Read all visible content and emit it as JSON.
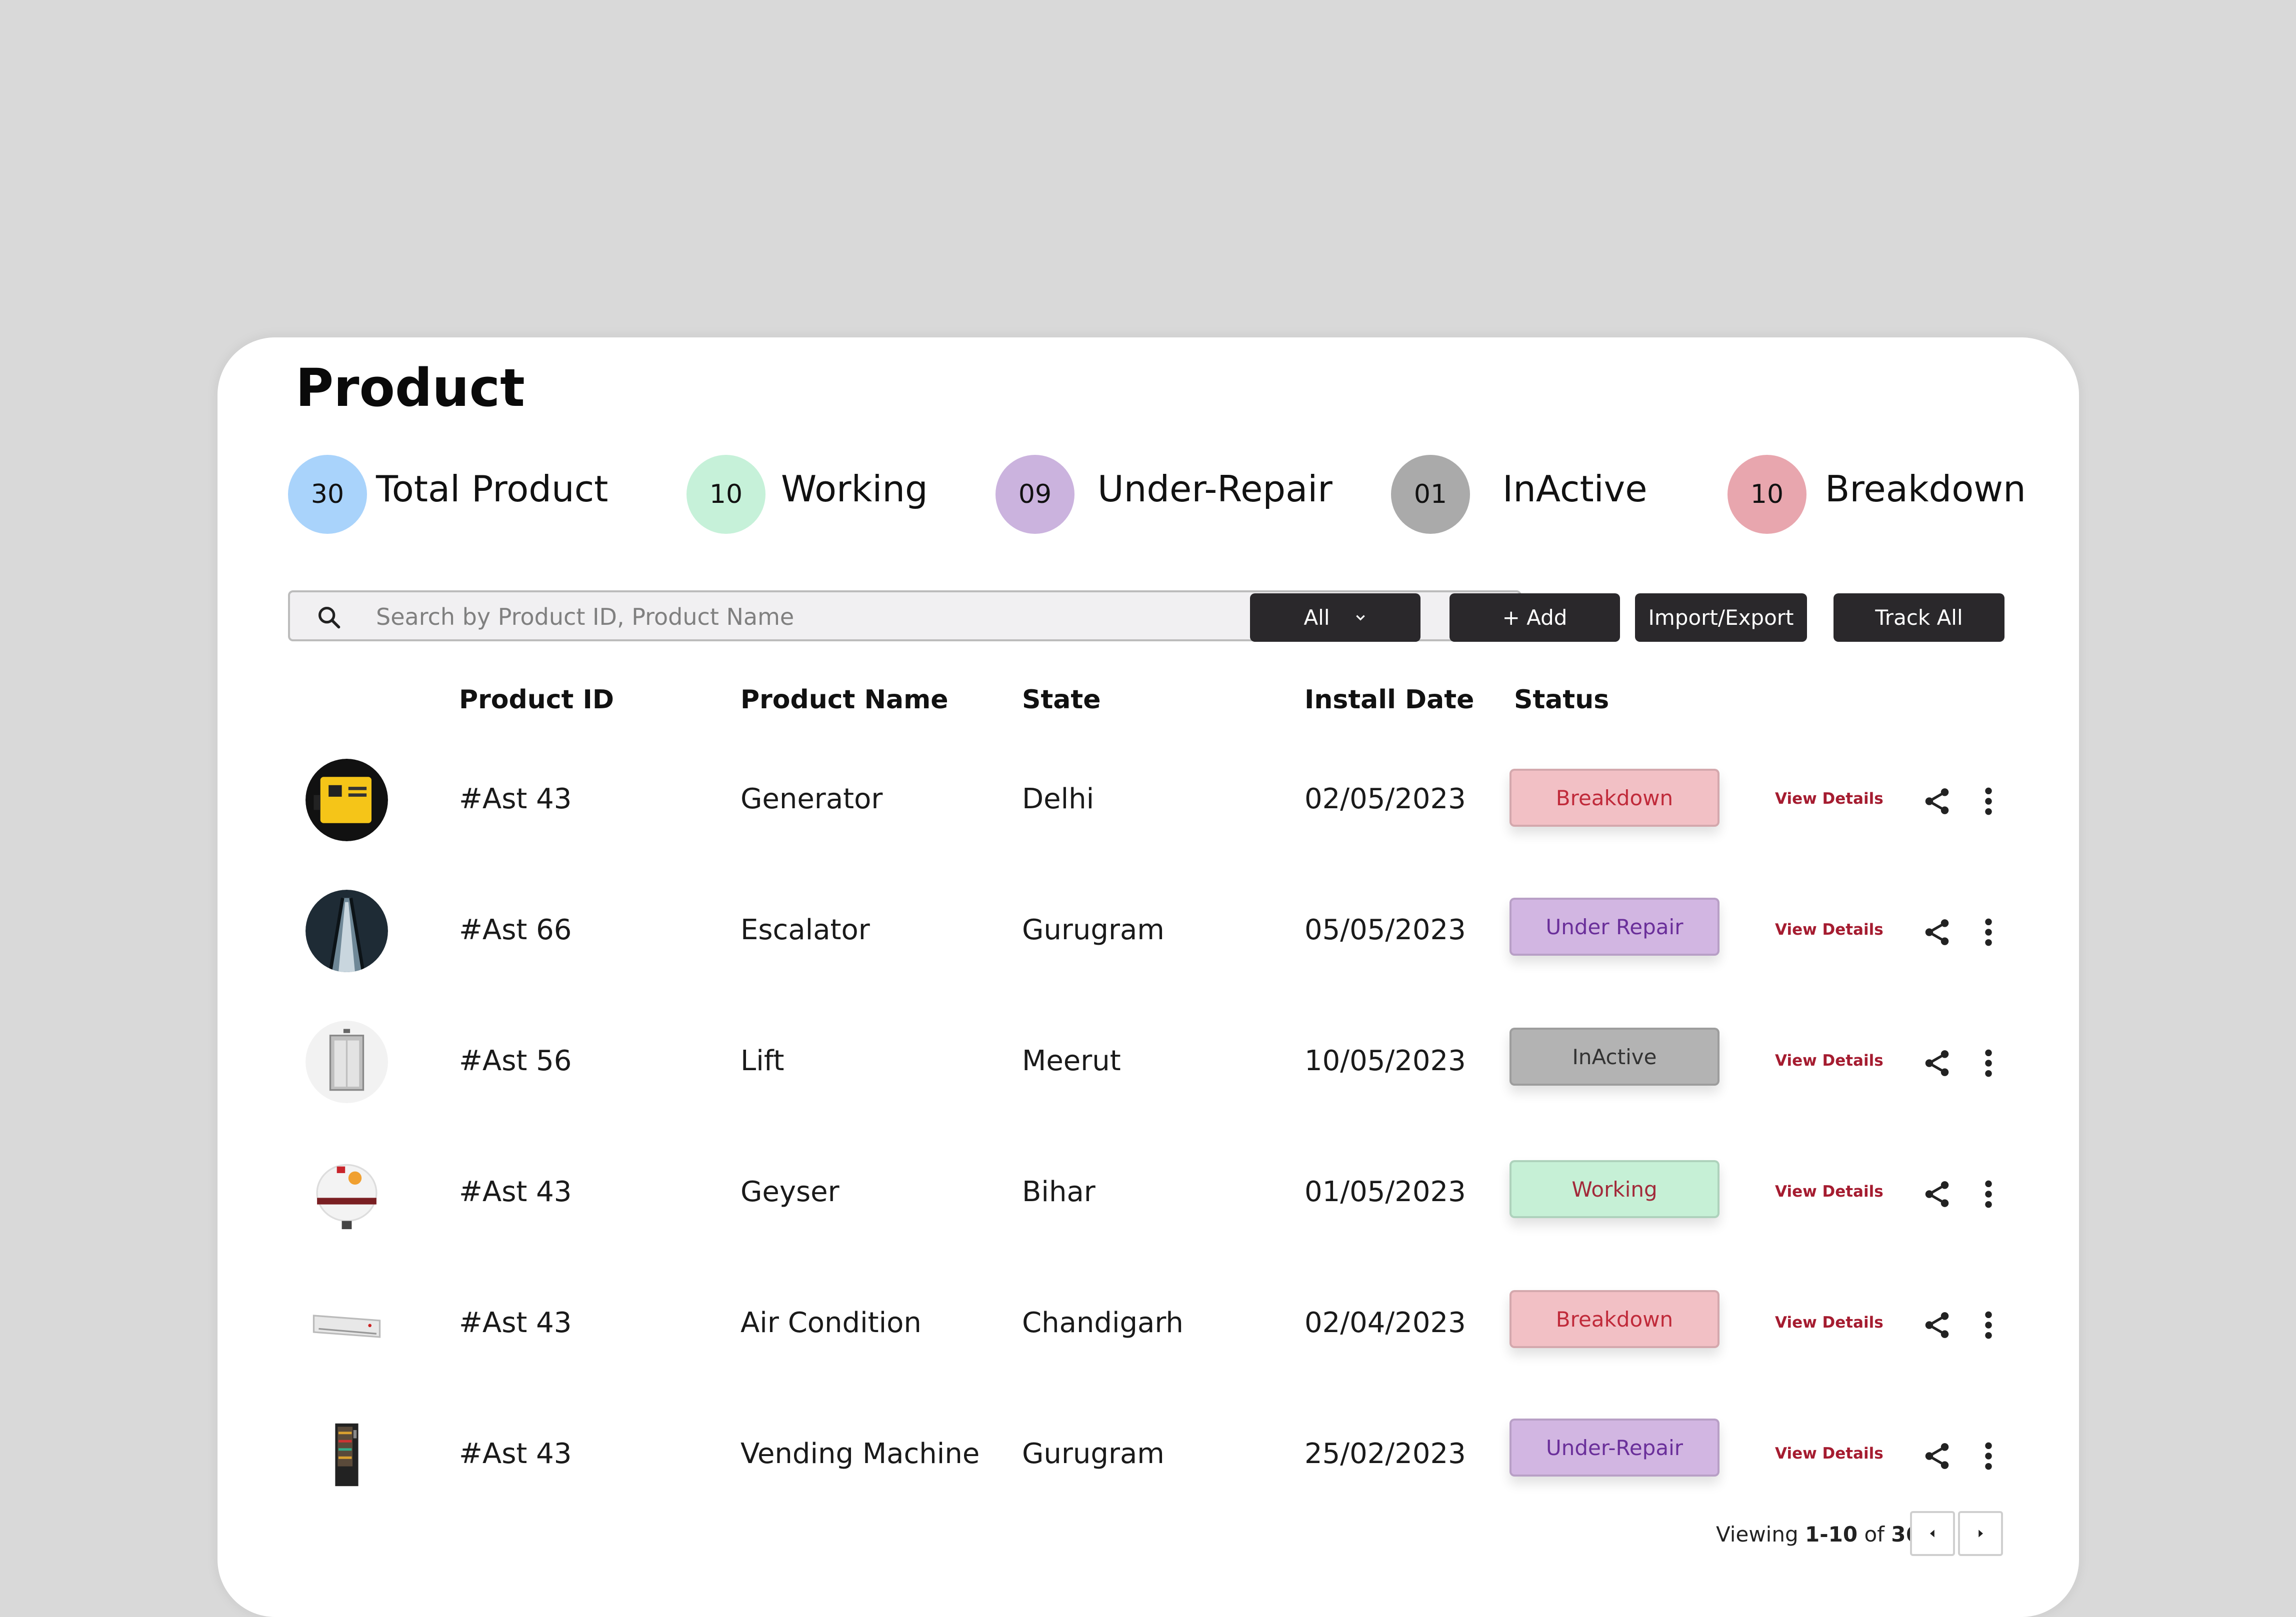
{
  "page": {
    "title": "Product"
  },
  "stats": [
    {
      "count": "30",
      "label": "Total Product",
      "color": "#a9d3fb"
    },
    {
      "count": "10",
      "label": "Working",
      "color": "#c6f1d9"
    },
    {
      "count": "09",
      "label": "Under-Repair",
      "color": "#cbb3de"
    },
    {
      "count": "01",
      "label": "InActive",
      "color": "#aaaaaa"
    },
    {
      "count": "10",
      "label": "Breakdown",
      "color": "#e8a6ae"
    }
  ],
  "search": {
    "placeholder": "Search by Product ID, Product Name",
    "value": ""
  },
  "toolbar": {
    "filter_value": "All",
    "add_label": "+ Add",
    "import_export_label": "Import/Export",
    "track_all_label": "Track All"
  },
  "table": {
    "headers": {
      "product_id": "Product ID",
      "product_name": "Product Name",
      "state": "State",
      "install_date": "Install Date",
      "status": "Status"
    },
    "view_label": "View Details",
    "rows": [
      {
        "id": "#Ast 43",
        "name": "Generator",
        "state": "Delhi",
        "date": "02/05/2023",
        "status": "Breakdown",
        "thumb": "generator-image"
      },
      {
        "id": "#Ast 66",
        "name": "Escalator",
        "state": "Gurugram",
        "date": "05/05/2023",
        "status": "Under Repair",
        "thumb": "escalator-image"
      },
      {
        "id": "#Ast 56",
        "name": "Lift",
        "state": "Meerut",
        "date": "10/05/2023",
        "status": "InActive",
        "thumb": "lift-image"
      },
      {
        "id": "#Ast 43",
        "name": "Geyser",
        "state": "Bihar",
        "date": "01/05/2023",
        "status": "Working",
        "thumb": "geyser-image"
      },
      {
        "id": "#Ast 43",
        "name": "Air Condition",
        "state": "Chandigarh",
        "date": "02/04/2023",
        "status": "Breakdown",
        "thumb": "air-conditioner-image"
      },
      {
        "id": "#Ast 43",
        "name": "Vending Machine",
        "state": "Gurugram",
        "date": "25/02/2023",
        "status": "Under-Repair",
        "thumb": "vending-machine-image"
      }
    ]
  },
  "status_colors": {
    "breakdown": {
      "bg": "#f2c0c5",
      "text": "#c02a3a"
    },
    "under_repair": {
      "bg": "#d2b6e2",
      "text": "#6a2f9a"
    },
    "inactive": {
      "bg": "#b3b3b3",
      "text": "#333333"
    },
    "working": {
      "bg": "#c6f0d6",
      "text": "#a22a3a"
    }
  },
  "pagination": {
    "prefix": "Viewing",
    "range": "1-10",
    "of": "of",
    "total": "36"
  },
  "icons": {
    "search": "search-icon",
    "chevron": "chevron-down-icon",
    "share": "share-icon",
    "more": "more-vertical-icon",
    "prev": "chevron-left-icon",
    "next": "chevron-right-icon"
  }
}
